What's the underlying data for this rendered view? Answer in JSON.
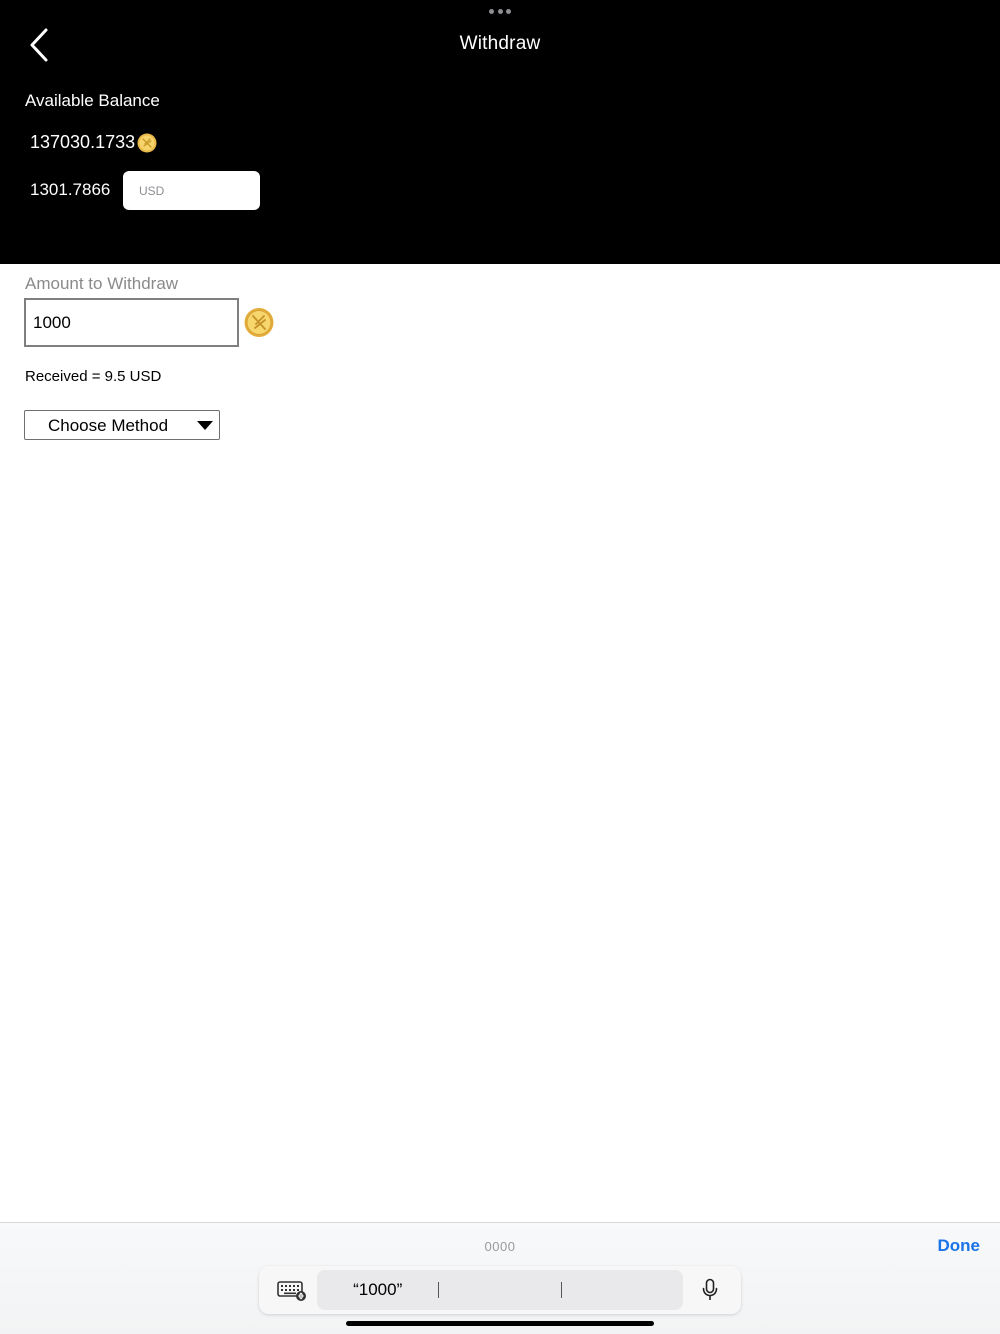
{
  "nav": {
    "title": "Withdraw"
  },
  "balance": {
    "label": "Available Balance",
    "coins": "137030.1733",
    "usd_value": "1301.7866",
    "currency_placeholder": "USD"
  },
  "form": {
    "amount_label": "Amount to Withdraw",
    "amount_value": "1000",
    "received_text": "Received = 9.5 USD",
    "method_label": "Choose Method"
  },
  "keyboard": {
    "hint": "0000",
    "done_label": "Done",
    "suggestions": [
      "“1000”",
      "",
      ""
    ]
  },
  "icons": {
    "back": "chevron-left-icon",
    "coin": "coin-icon",
    "keyboard": "keyboard-icon",
    "mic": "microphone-icon"
  },
  "colors": {
    "header_bg": "#000000",
    "coin_gold": "#f2c94c",
    "done_blue": "#1a73e8",
    "caret_blue": "#1f5bff"
  }
}
